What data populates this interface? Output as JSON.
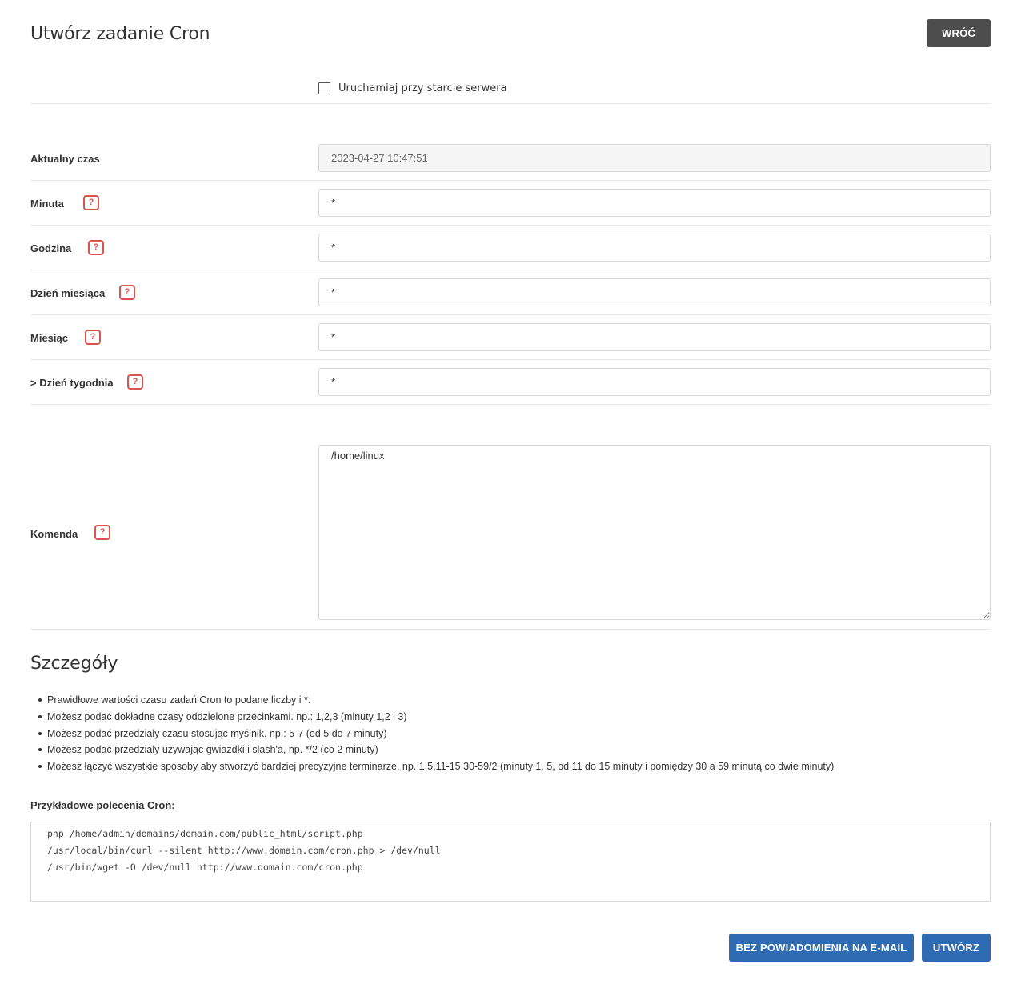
{
  "header": {
    "title": "Utwórz zadanie Cron",
    "back_label": "WRÓĆ"
  },
  "options": {
    "run_on_boot_label": "Uruchamiaj przy starcie serwera",
    "run_on_boot_checked": false
  },
  "fields": {
    "current_time": {
      "label": "Aktualny czas",
      "value": "2023-04-27 10:47:51"
    },
    "minute": {
      "label": "Minuta",
      "value": "*",
      "help": "?"
    },
    "hour": {
      "label": "Godzina",
      "value": "*",
      "help": "?"
    },
    "day_of_month": {
      "label": "Dzień miesiąca",
      "value": "*",
      "help": "?"
    },
    "month": {
      "label": "Miesiąc",
      "value": "*",
      "help": "?"
    },
    "day_of_week": {
      "label": "> Dzień tygodnia",
      "value": "*",
      "help": "?"
    },
    "command": {
      "label": "Komenda",
      "value": "/home/linux",
      "help": "?"
    }
  },
  "details": {
    "title": "Szczegóły",
    "items": [
      "Prawidłowe wartości czasu zadań Cron to podane liczby i *.",
      "Możesz podać dokładne czasy oddzielone przecinkami. np.: 1,2,3 (minuty 1,2 i 3)",
      "Możesz podać przedziały czasu stosując myślnik. np.: 5-7 (od 5 do 7 minuty)",
      "Możesz podać przedziały używając gwiazdki i slash'a, np. */2 (co 2 minuty)",
      "Możesz łączyć wszystkie sposoby aby stworzyć bardziej precyzyjne terminarze, np. 1,5,11-15,30-59/2 (minuty 1, 5, od 11 do 15 minuty i pomiędzy 30 a 59 minutą co dwie minuty)"
    ],
    "examples_title": "Przykładowe polecenia Cron:",
    "examples": [
      "php /home/admin/domains/domain.com/public_html/script.php",
      "/usr/local/bin/curl --silent http://www.domain.com/cron.php > /dev/null",
      "/usr/bin/wget -O /dev/null http://www.domain.com/cron.php"
    ]
  },
  "footer": {
    "no_email_label": "BEZ POWIADOMIENIA NA E-MAIL",
    "create_label": "UTWÓRZ"
  },
  "colors": {
    "primary_button": "#2f6bb3",
    "back_button": "#4d4d4d",
    "help_badge": "#d9534f"
  }
}
